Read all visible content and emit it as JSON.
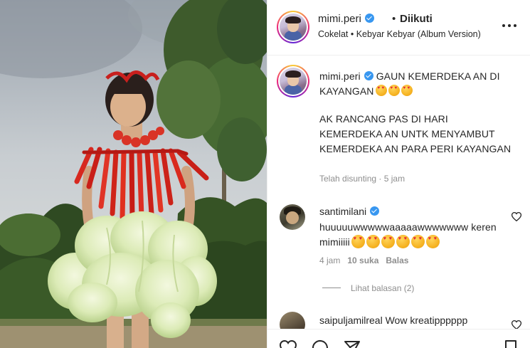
{
  "media": {
    "description_icon": "reel-video"
  },
  "header": {
    "username": "mimi.peri",
    "separator": "•",
    "follow_status": "Diikuti",
    "audio": "Cokelat • Kebyar Kebyar (Album Version)",
    "more_icon": "more-horizontal-icon"
  },
  "caption": {
    "username": "mimi.peri",
    "title_text": "GAUN KEMERDEKA AN DI KAYANGAN",
    "body": "AK RANCANG PAS DI HARI KEMERDEKA AN UNTK MENYAMBUT KEMERDEKA AN PARA PERI KAYANGAN",
    "meta": "Telah disunting · 5 jam"
  },
  "comments": [
    {
      "username": "santimilani",
      "text": "huuuuuwwwwwaaaaawwwwwww keren mimiiiii",
      "time": "4 jam",
      "likes": "10 suka",
      "reply": "Balas",
      "view_replies": "Lihat balasan (2)"
    },
    {
      "username": "saipuljamilreal",
      "text": "Wow kreatipppppp"
    }
  ],
  "colors": {
    "verified": "#3897f0",
    "text": "#262626",
    "muted": "#8e8e8e",
    "divider": "#efefef"
  }
}
